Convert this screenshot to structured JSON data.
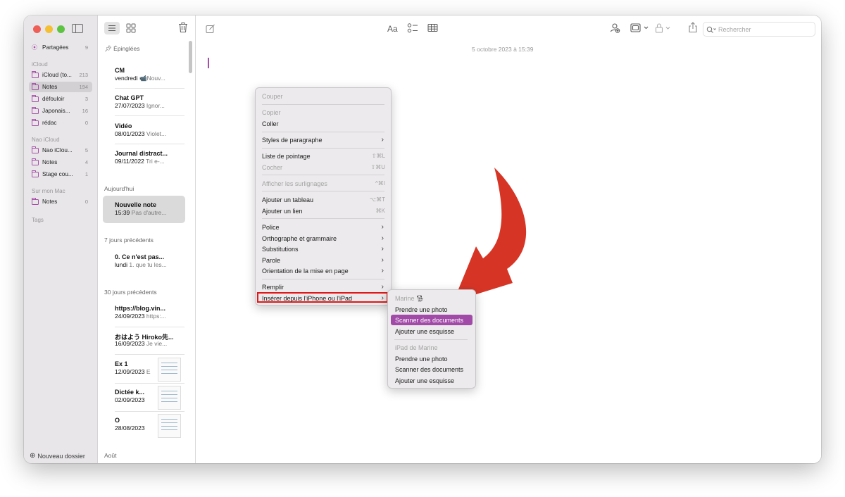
{
  "colors": {
    "accent": "#a64ea8",
    "arrow": "#d63526",
    "highlight": "#a14aa8",
    "box": "#e01818"
  },
  "sidebar": {
    "shared": {
      "label": "Partagées",
      "count": "9"
    },
    "groups": [
      {
        "title": "iCloud",
        "items": [
          {
            "label": "iCloud (to...",
            "count": "213"
          },
          {
            "label": "Notes",
            "count": "194"
          },
          {
            "label": "défouloir",
            "count": "3"
          },
          {
            "label": "Japonais...",
            "count": "16"
          },
          {
            "label": "rédac",
            "count": "0"
          }
        ]
      },
      {
        "title": "Nao iCloud",
        "items": [
          {
            "label": "Nao iClou...",
            "count": "5"
          },
          {
            "label": "Notes",
            "count": "4"
          },
          {
            "label": "Stage cou...",
            "count": "1"
          }
        ]
      },
      {
        "title": "Sur mon Mac",
        "items": [
          {
            "label": "Notes",
            "count": "0"
          }
        ]
      }
    ],
    "tags": "Tags",
    "new_folder": "Nouveau dossier"
  },
  "list": {
    "pinned_header": "Épinglées",
    "pinned": [
      {
        "title": "CM",
        "date": "vendredi",
        "preview": "📹Nouv..."
      },
      {
        "title": "Chat GPT",
        "date": "27/07/2023",
        "preview": "Ignor..."
      },
      {
        "title": "Vidéo",
        "date": "08/01/2023",
        "preview": "Violet..."
      },
      {
        "title": "Journal distract...",
        "date": "09/11/2022",
        "preview": "Tri e-..."
      }
    ],
    "today_header": "Aujourd'hui",
    "today": [
      {
        "title": "Nouvelle note",
        "date": "15:39",
        "preview": "Pas d'autre..."
      }
    ],
    "week_header": "7 jours précédents",
    "week": [
      {
        "title": "0. Ce n'est pas...",
        "date": "lundi",
        "preview": "1. que tu les..."
      }
    ],
    "month_header": "30 jours précédents",
    "month": [
      {
        "title": "https://blog.vin...",
        "date": "24/09/2023",
        "preview": "https:..."
      },
      {
        "title": "おはよう Hiroko先...",
        "date": "16/09/2023",
        "preview": "Je vie..."
      },
      {
        "title": "Ex 1",
        "date": "12/09/2023",
        "preview": "E"
      },
      {
        "title": "Dictée k...",
        "date": "02/09/2023",
        "preview": ""
      },
      {
        "title": "O",
        "date": "28/08/2023",
        "preview": ""
      }
    ],
    "august_header": "Août"
  },
  "editor": {
    "font_button": "Aa",
    "search_placeholder": "Rechercher",
    "date": "5 octobre 2023 à 15:39"
  },
  "context_menu": {
    "items": [
      {
        "label": "Couper",
        "disabled": true
      },
      {
        "label": "Copier",
        "disabled": true
      },
      {
        "label": "Coller"
      },
      {
        "label": "Styles de paragraphe",
        "submenu": true
      },
      {
        "label": "Liste de pointage",
        "shortcut": "⇧⌘L"
      },
      {
        "label": "Cocher",
        "shortcut": "⇧⌘U",
        "disabled": true
      },
      {
        "label": "Afficher les surlignages",
        "shortcut": "^⌘I",
        "disabled": true
      },
      {
        "label": "Ajouter un tableau",
        "shortcut": "⌥⌘T"
      },
      {
        "label": "Ajouter un lien",
        "shortcut": "⌘K"
      },
      {
        "label": "Police",
        "submenu": true
      },
      {
        "label": "Orthographe et grammaire",
        "submenu": true
      },
      {
        "label": "Substitutions",
        "submenu": true
      },
      {
        "label": "Parole",
        "submenu": true
      },
      {
        "label": "Orientation de la mise en page",
        "submenu": true
      },
      {
        "label": "Remplir",
        "submenu": true
      },
      {
        "label": "Insérer depuis l'iPhone ou l'iPad",
        "submenu": true
      }
    ]
  },
  "submenu": {
    "device1": "Marine",
    "device1_items": [
      "Prendre une photo",
      "Scanner des documents",
      "Ajouter une esquisse"
    ],
    "device2": "iPad de Marine",
    "device2_items": [
      "Prendre une photo",
      "Scanner des documents",
      "Ajouter une esquisse"
    ],
    "highlighted": "Scanner des documents"
  }
}
